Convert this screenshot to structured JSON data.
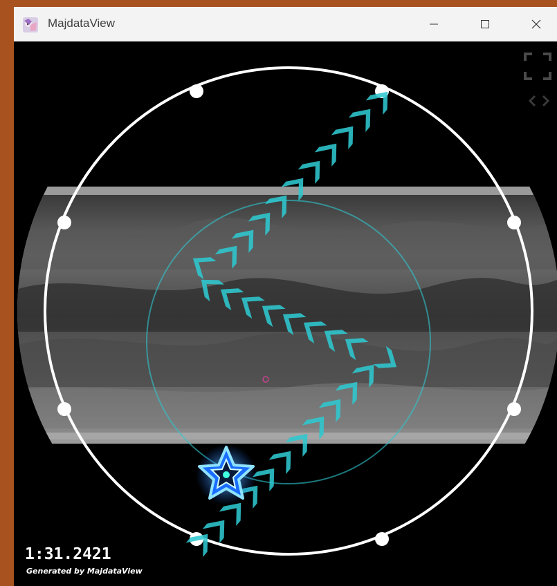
{
  "window": {
    "title": "MajdataView",
    "controls": {
      "minimize": "minimize",
      "maximize": "maximize",
      "close": "close"
    }
  },
  "icons": {
    "app": "app-anime-icon",
    "fullscreen": "fullscreen-icon",
    "nav": "chevron-left-right-icon",
    "star": "star-tap-icon"
  },
  "playback": {
    "timecode": "1:31.2421",
    "credit": "Generated by MajdataView"
  },
  "colors": {
    "accent": "#2fc7cf",
    "ring": "#ffffff",
    "star": "#1a6dff",
    "center_marker": "#e0409a"
  }
}
